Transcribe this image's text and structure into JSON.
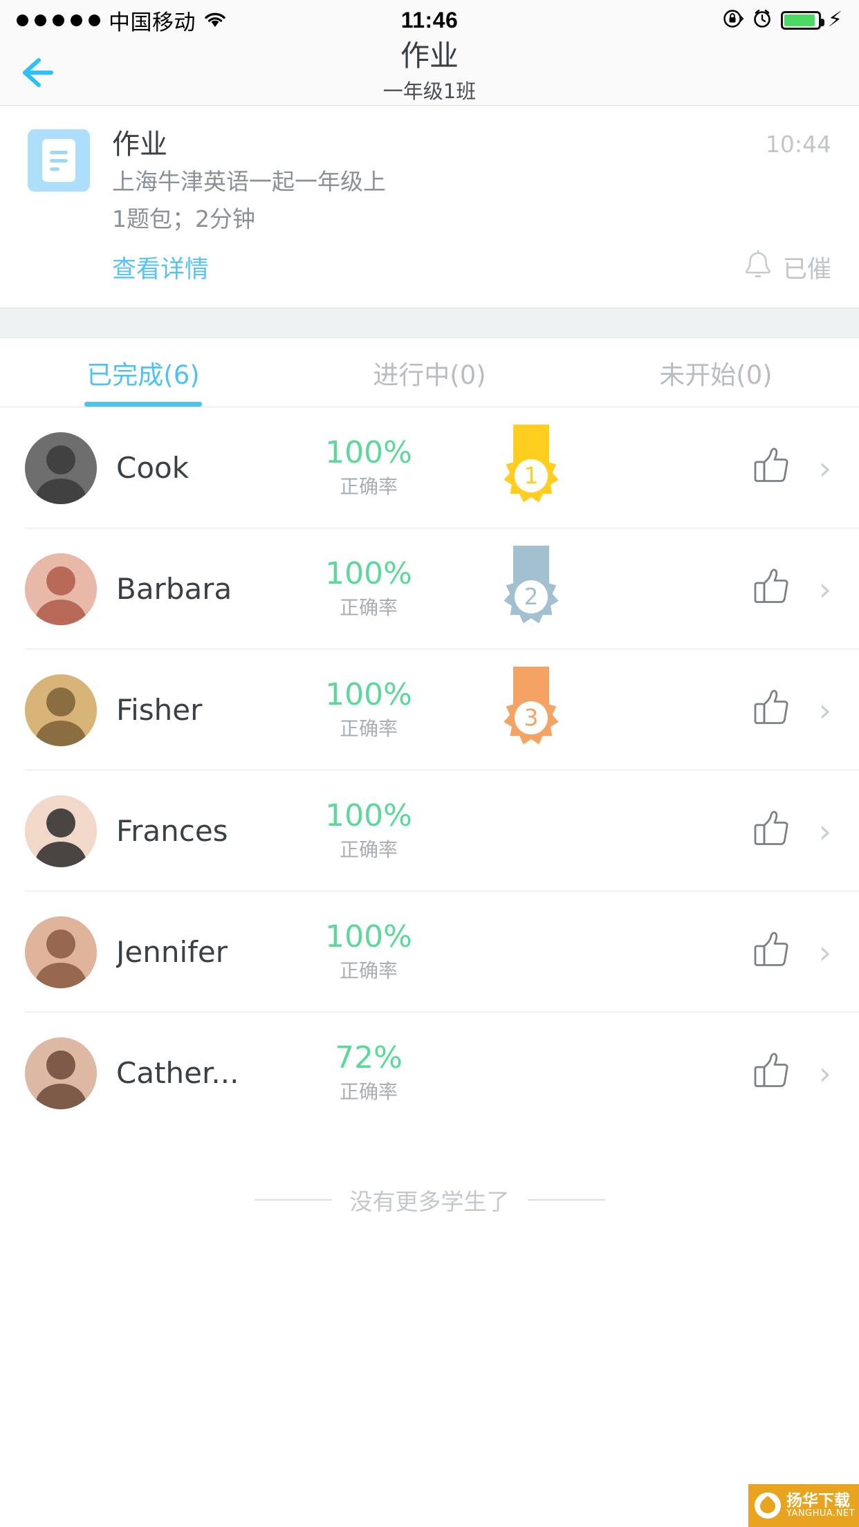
{
  "status_bar": {
    "signal_dots": 5,
    "carrier": "中国移动",
    "time": "11:46",
    "battery_level_pct": 92,
    "battery_color": "#4CD964",
    "icons": [
      "wifi-icon",
      "rotation-lock-icon",
      "alarm-clock-icon",
      "battery-icon",
      "charging-bolt-icon"
    ]
  },
  "navbar": {
    "back_icon": "back-arrow-icon",
    "title": "作业",
    "subtitle": "一年级1班"
  },
  "assignment_card": {
    "icon": "document-icon",
    "title": "作业",
    "description_line1": "上海牛津英语一起一年级上",
    "description_line2": "1题包；2分钟",
    "time": "10:44",
    "detail_link": "查看详情",
    "remind_icon": "bell-icon",
    "remind_label": "已催"
  },
  "tabs": [
    {
      "label": "已完成(6)",
      "active": true
    },
    {
      "label": "进行中(0)",
      "active": false
    },
    {
      "label": "未开始(0)",
      "active": false
    }
  ],
  "colors": {
    "accent_blue": "#4fc2f3",
    "score_green": "#5CD99A",
    "gold": "#FFCE1F",
    "silver": "#A2C0D0",
    "bronze": "#F5A364",
    "card_icon_bg": "#AEDFFA"
  },
  "score_label": "正确率",
  "students": [
    {
      "name": "Cook",
      "score": "100%",
      "score_label": "正确率",
      "rank": "1",
      "medal": "gold",
      "avatar": "avatar-cook",
      "thumb_icon": "thumbs-up-icon",
      "chevron": "›"
    },
    {
      "name": "Barbara",
      "score": "100%",
      "score_label": "正确率",
      "rank": "2",
      "medal": "silver",
      "avatar": "avatar-barbara",
      "thumb_icon": "thumbs-up-icon",
      "chevron": "›"
    },
    {
      "name": "Fisher",
      "score": "100%",
      "score_label": "正确率",
      "rank": "3",
      "medal": "bronze",
      "avatar": "avatar-fisher",
      "thumb_icon": "thumbs-up-icon",
      "chevron": "›"
    },
    {
      "name": "Frances",
      "score": "100%",
      "score_label": "正确率",
      "rank": "",
      "medal": "none",
      "avatar": "avatar-frances",
      "thumb_icon": "thumbs-up-icon",
      "chevron": "›"
    },
    {
      "name": "Jennifer",
      "score": "100%",
      "score_label": "正确率",
      "rank": "",
      "medal": "none",
      "avatar": "avatar-jennifer",
      "thumb_icon": "thumbs-up-icon",
      "chevron": "›"
    },
    {
      "name": "Cather...",
      "score": "72%",
      "score_label": "正确率",
      "rank": "",
      "medal": "none",
      "avatar": "avatar-catherine",
      "thumb_icon": "thumbs-up-icon",
      "chevron": "›"
    }
  ],
  "footer": {
    "text": "没有更多学生了"
  },
  "watermark": {
    "line1": "扬华下载",
    "line2": "YANGHUA.NET"
  }
}
